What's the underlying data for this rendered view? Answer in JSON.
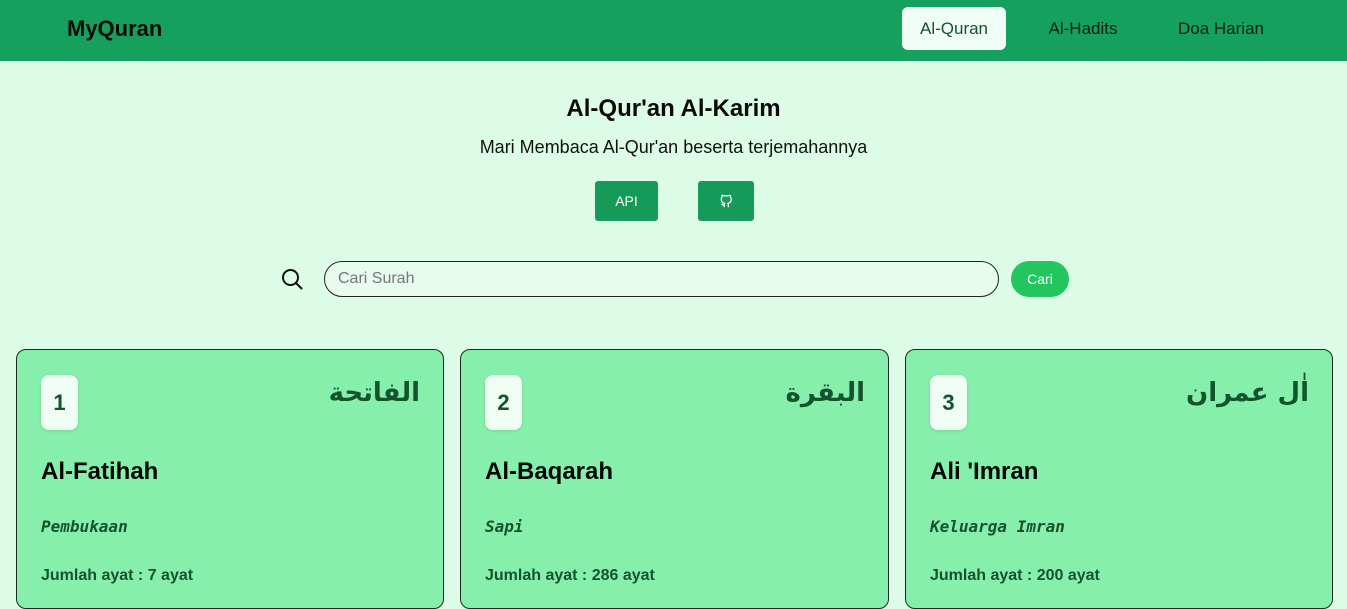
{
  "navbar": {
    "brand": "MyQuran",
    "links": [
      {
        "label": "Al-Quran",
        "active": true
      },
      {
        "label": "Al-Hadits",
        "active": false
      },
      {
        "label": "Doa Harian",
        "active": false
      }
    ]
  },
  "hero": {
    "title": "Al-Qur'an Al-Karim",
    "subtitle": "Mari Membaca Al-Qur'an beserta terjemahannya",
    "api_button": "API",
    "github_icon": "github-icon"
  },
  "search": {
    "placeholder": "Cari Surah",
    "value": "",
    "button_label": "Cari",
    "icon": "search-icon"
  },
  "surahs": [
    {
      "number": "1",
      "arabic": "الفاتحة",
      "name": "Al-Fatihah",
      "meaning": "Pembukaan",
      "ayat": "Jumlah ayat : 7 ayat"
    },
    {
      "number": "2",
      "arabic": "البقرة",
      "name": "Al-Baqarah",
      "meaning": "Sapi",
      "ayat": "Jumlah ayat : 286 ayat"
    },
    {
      "number": "3",
      "arabic": "اٰل عمران",
      "name": "Ali 'Imran",
      "meaning": "Keluarga Imran",
      "ayat": "Jumlah ayat : 200 ayat"
    }
  ],
  "colors": {
    "navbar": "#16a05d",
    "page_background": "#dcfce7",
    "card_background": "#86efac",
    "primary_button": "#159a5a",
    "search_button": "#22c55e",
    "dark_green_text": "#14532d"
  }
}
